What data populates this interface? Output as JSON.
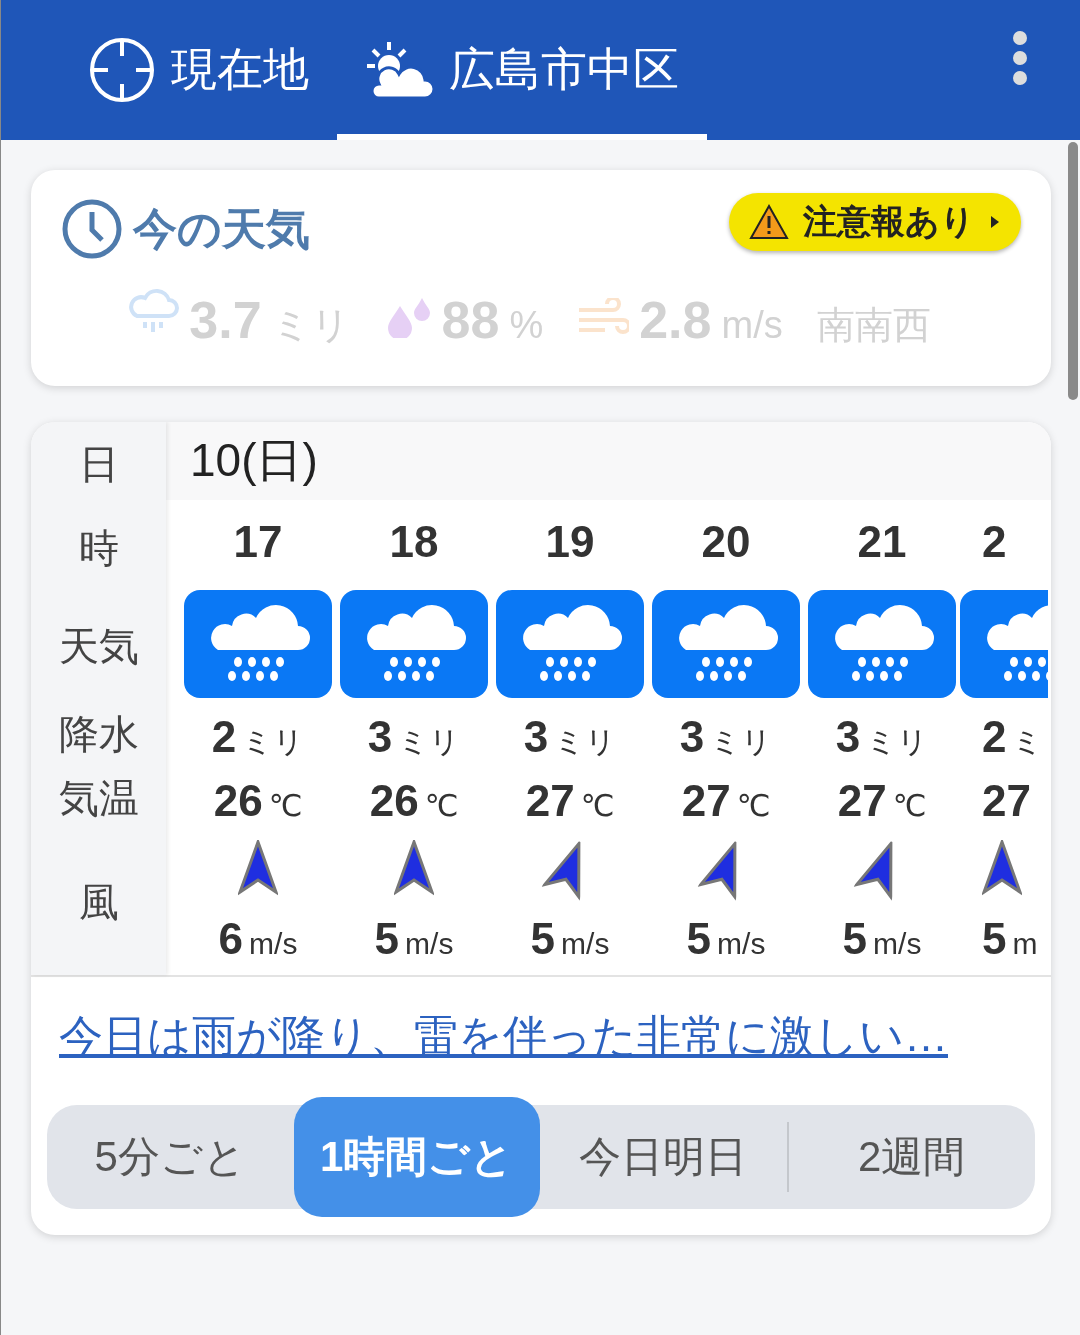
{
  "header": {
    "tabs": [
      {
        "kind": "location",
        "label": "現在地",
        "selected": false
      },
      {
        "kind": "weather",
        "label": "広島市中区",
        "selected": true
      }
    ]
  },
  "current": {
    "title": "今の天気",
    "alert": "注意報あり",
    "precip_value": "3.7",
    "precip_unit": "ミリ",
    "humidity_value": "88",
    "humidity_unit": "%",
    "wind_value": "2.8",
    "wind_unit": "m/s",
    "wind_dir": "南南西"
  },
  "hourly": {
    "row_labels": [
      "日",
      "時",
      "天気",
      "降水",
      "気温",
      "風"
    ],
    "date": "10(日)",
    "columns": [
      {
        "hour": "17",
        "precip": "2",
        "precip_unit": "ミリ",
        "temp": "26",
        "temp_unit": "℃",
        "rotated": false,
        "wind": "6",
        "wind_unit": "m/s"
      },
      {
        "hour": "18",
        "precip": "3",
        "precip_unit": "ミリ",
        "temp": "26",
        "temp_unit": "℃",
        "rotated": false,
        "wind": "5",
        "wind_unit": "m/s"
      },
      {
        "hour": "19",
        "precip": "3",
        "precip_unit": "ミリ",
        "temp": "27",
        "temp_unit": "℃",
        "rotated": true,
        "wind": "5",
        "wind_unit": "m/s"
      },
      {
        "hour": "20",
        "precip": "3",
        "precip_unit": "ミリ",
        "temp": "27",
        "temp_unit": "℃",
        "rotated": true,
        "wind": "5",
        "wind_unit": "m/s"
      },
      {
        "hour": "21",
        "precip": "3",
        "precip_unit": "ミリ",
        "temp": "27",
        "temp_unit": "℃",
        "rotated": true,
        "wind": "5",
        "wind_unit": "m/s"
      },
      {
        "hour": "2",
        "precip": "2",
        "precip_unit": "ミ",
        "temp": "27",
        "rotated": false,
        "wind": "5",
        "wind_unit": "m"
      }
    ]
  },
  "summary_link": "今日は雨が降り、雷を伴った非常に激しい…",
  "range_tabs": [
    {
      "label": "5分ごと",
      "selected": false
    },
    {
      "label": "1時間ごと",
      "selected": true
    },
    {
      "label": "今日明日",
      "selected": false
    },
    {
      "label": "2週間",
      "selected": false
    }
  ]
}
